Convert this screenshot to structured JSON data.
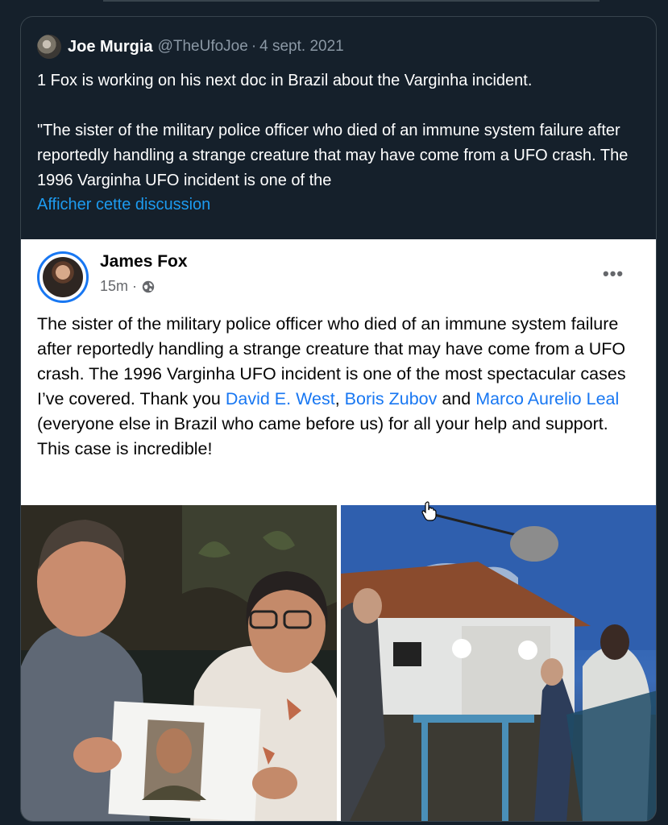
{
  "quote": {
    "author_name": "Joe Murgia",
    "author_handle": "@TheUfoJoe",
    "separator": "·",
    "date": "4 sept. 2021",
    "lines": [
      "1 Fox is working on his next doc in Brazil about the Varginha incident.",
      "\"The sister of the military police officer who died of an immune system failure after reportedly handling a strange creature that may have come from a UFO crash. The 1996 Varginha UFO incident is one of the"
    ],
    "show_thread_label": "Afficher cette discussion"
  },
  "fb_post": {
    "author_name": "James Fox",
    "time": "15m",
    "separator": "·",
    "more_label": "•••",
    "text_part1": "The sister of the military police officer who died of an immune system failure after reportedly handling a strange creature that may have come from a UFO crash. The 1996 Varginha UFO incident is one of the most spectacular cases I’ve covered. Thank you ",
    "mention1": "David E. West",
    "text_part2": ", ",
    "mention2": "Boris Zubov",
    "text_part3": " and ",
    "mention3": "Marco Aurelio Leal",
    "text_part4": " (everyone else in Brazil who came before us)  for all your help and support. This case is incredible!",
    "icons": {
      "privacy": "globe-icon",
      "menu": "more-icon"
    }
  },
  "colors": {
    "background": "#15202b",
    "text": "#ffffff",
    "secondary_text": "#8b98a5",
    "link": "#1d9bf0",
    "fb_link": "#1877f2"
  }
}
